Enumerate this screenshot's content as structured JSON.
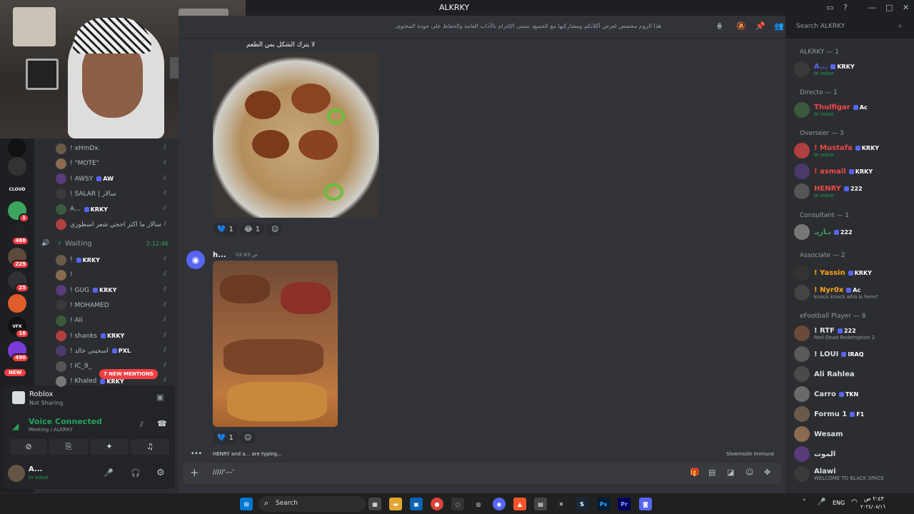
{
  "window": {
    "title": "ALKRKY",
    "search_placeholder": "Search ALKRKY"
  },
  "channel": {
    "topic": "هذا الروم مخصص لعرض أكلاتكم ومشاركتها مع الجميع، نتمنى الإلتزام بالآداب العامة والحفاظ على جودة المحتوى."
  },
  "servers": {
    "badges": [
      "1",
      "488",
      "229",
      "25",
      "18",
      "490"
    ],
    "new_label": "NEW",
    "icons": [
      "",
      "",
      "CLOUD",
      "",
      "",
      "",
      "",
      "",
      "VFX",
      ""
    ]
  },
  "voice_users": [
    {
      "name": "! xHmDx.",
      "tag": ""
    },
    {
      "name": "! \"MOTE\"",
      "tag": ""
    },
    {
      "name": "! AWSY",
      "tag": "AW"
    },
    {
      "name": "! SALAR | سالار",
      "tag": ""
    },
    {
      "name": "A...",
      "tag": "KRKY"
    },
    {
      "name": "سالار ما اكثر احجي شعر اسطوري",
      "tag": ""
    }
  ],
  "waiting": {
    "label": "Waiting",
    "timer": "2:12:46"
  },
  "waiting_users": [
    {
      "name": "!",
      "tag": "KRKY"
    },
    {
      "name": "!",
      "tag": ""
    },
    {
      "name": "! GUG",
      "tag": "KRKY"
    },
    {
      "name": "! MOHAMED",
      "tag": ""
    },
    {
      "name": "! Ali",
      "tag": ""
    },
    {
      "name": "! shanks",
      "tag": "KRKY"
    },
    {
      "name": "! اسحيني خالد",
      "tag": "PXL"
    },
    {
      "name": "! IC_9_",
      "tag": ""
    },
    {
      "name": "! Khaled",
      "tag": "KRKY"
    }
  ],
  "mentions_pill": "7 NEW MENTIONS",
  "activity": {
    "game": "Roblox",
    "status": "Not Sharing"
  },
  "voice_status": {
    "label": "Voice Connected",
    "channel": "Meeting / ALKRKY"
  },
  "user_panel": {
    "name": "A...",
    "status": "In voice"
  },
  "messages": {
    "msg1_text": "لا يترك الشكل بس الطعم",
    "msg1_reactions": [
      {
        "emoji": "💙",
        "count": "1"
      },
      {
        "emoji": "😂",
        "count": "1"
      }
    ],
    "msg2_author": "h...",
    "msg2_time": "02:43 ص",
    "msg2_reactions": [
      {
        "emoji": "💙",
        "count": "1"
      }
    ]
  },
  "typing": {
    "text": "HENRY and a... are typing...",
    "slowmode": "Slowmode Immune"
  },
  "composer": {
    "value": "/////'---'"
  },
  "members": {
    "groups": [
      {
        "header": "ALKRKY — 1"
      },
      {
        "header": "Directo — 1"
      },
      {
        "header": "Overseer — 3"
      },
      {
        "header": "Consultant — 1"
      },
      {
        "header": "Associate — 2"
      },
      {
        "header": "eFootball Player — 8"
      }
    ],
    "rows": [
      {
        "name": "A...",
        "tag": "KRKY",
        "sub": "In voice",
        "color": "#5865f2"
      },
      {
        "name": "Thulfigar",
        "tag": "Ac",
        "sub": "In voice",
        "color": "#f04747"
      },
      {
        "name": "! Mustafa",
        "tag": "KRKY",
        "sub": "In voice",
        "color": "#f04747"
      },
      {
        "name": "! asmail",
        "tag": "KRKY",
        "sub": "",
        "color": "#f04747"
      },
      {
        "name": "HENRY",
        "tag": "222",
        "sub": "In voice",
        "color": "#f04747"
      },
      {
        "name": "بـاريـ",
        "tag": "222",
        "sub": "",
        "color": "#3ba55d"
      },
      {
        "name": "! Yassin",
        "tag": "KRKY",
        "sub": "",
        "color": "#faa61a"
      },
      {
        "name": "! Nyr0x",
        "tag": "Ac",
        "sub": "knock knock who is here?",
        "color": "#faa61a"
      },
      {
        "name": "! RTF",
        "tag": "222",
        "sub": "Red Dead Redemption 2",
        "color": "#dbdee1"
      },
      {
        "name": "! LOUI",
        "tag": "IRAQ",
        "sub": "",
        "color": "#dbdee1"
      },
      {
        "name": "Ali Rahlea",
        "tag": "",
        "sub": "",
        "color": "#dbdee1"
      },
      {
        "name": "Carro",
        "tag": "TKN",
        "sub": "",
        "color": "#dbdee1"
      },
      {
        "name": "Formu 1",
        "tag": "F1",
        "sub": "",
        "color": "#dbdee1"
      },
      {
        "name": "Wesam",
        "tag": "",
        "sub": "",
        "color": "#dbdee1"
      },
      {
        "name": "الموت",
        "tag": "",
        "sub": "",
        "color": "#dbdee1"
      },
      {
        "name": "Alawi",
        "tag": "",
        "sub": "WELCOME TO BLACK SPACE",
        "color": "#dbdee1"
      }
    ]
  },
  "taskbar": {
    "search_label": "Search",
    "lang": "ENG",
    "time": "٢:٤٣ ص",
    "date": "٢٠٢٤/٠٨/١٦"
  },
  "colors": {
    "bg": "#313338",
    "sidebar": "#2b2d31",
    "accent": "#5865f2",
    "green": "#23a55a",
    "red": "#f23f43"
  }
}
